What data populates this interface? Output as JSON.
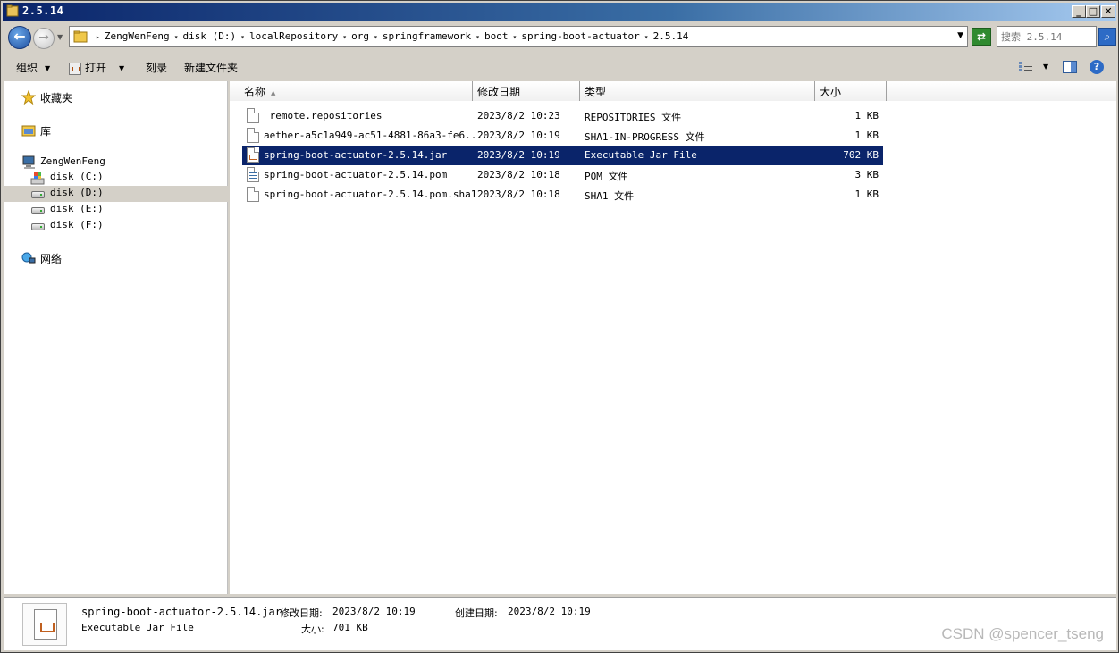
{
  "window": {
    "title": "2.5.14",
    "minimize": "_",
    "maximize": "□",
    "close": "✕"
  },
  "nav": {
    "back_glyph": "←",
    "forward_glyph": "→",
    "breadcrumbs": [
      "ZengWenFeng",
      "disk (D:)",
      "localRepository",
      "org",
      "springframework",
      "boot",
      "spring-boot-actuator",
      "2.5.14"
    ],
    "refresh_glyph": "⇄",
    "search_placeholder": "搜索 2.5.14",
    "search_glyph": "⌕"
  },
  "toolbar": {
    "organize": "组织",
    "open": "打开",
    "burn": "刻录",
    "new_folder": "新建文件夹",
    "help": "?"
  },
  "sidebar": {
    "favorites": "收藏夹",
    "libraries": "库",
    "computer": "ZengWenFeng",
    "drives": [
      {
        "label": "disk (C:)"
      },
      {
        "label": "disk (D:)"
      },
      {
        "label": "disk (E:)"
      },
      {
        "label": "disk (F:)"
      }
    ],
    "network": "网络"
  },
  "columns": {
    "name": "名称",
    "modified": "修改日期",
    "type": "类型",
    "size": "大小"
  },
  "files": [
    {
      "name": "_remote.repositories",
      "modified": "2023/8/2 10:23",
      "type": "REPOSITORIES 文件",
      "size": "1 KB",
      "icon": "file-icon"
    },
    {
      "name": "aether-a5c1a949-ac51-4881-86a3-fe6...",
      "modified": "2023/8/2 10:19",
      "type": "SHA1-IN-PROGRESS 文件",
      "size": "1 KB",
      "icon": "file-icon"
    },
    {
      "name": "spring-boot-actuator-2.5.14.jar",
      "modified": "2023/8/2 10:19",
      "type": "Executable Jar File",
      "size": "702 KB",
      "icon": "jar-file-icon",
      "selected": true
    },
    {
      "name": "spring-boot-actuator-2.5.14.pom",
      "modified": "2023/8/2 10:18",
      "type": "POM 文件",
      "size": "3 KB",
      "icon": "pom-file-icon"
    },
    {
      "name": "spring-boot-actuator-2.5.14.pom.sha1",
      "modified": "2023/8/2 10:18",
      "type": "SHA1 文件",
      "size": "1 KB",
      "icon": "file-icon"
    }
  ],
  "details": {
    "filename": "spring-boot-actuator-2.5.14.jar",
    "modified_label": "修改日期:",
    "modified_value": "2023/8/2 10:19",
    "created_label": "创建日期:",
    "created_value": "2023/8/2 10:19",
    "type": "Executable Jar File",
    "size_label": "大小:",
    "size_value": "701 KB"
  },
  "watermark": "CSDN @spencer_tseng",
  "colors": {
    "selection": "#0a246a",
    "title_start": "#0a246a",
    "title_end": "#a6caf0",
    "chrome": "#d4d0c8"
  }
}
